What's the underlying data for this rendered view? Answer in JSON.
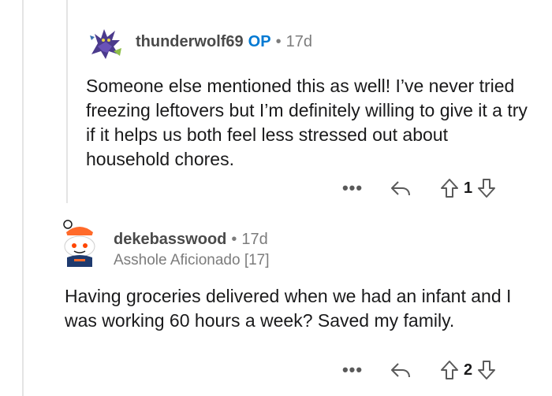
{
  "comments": [
    {
      "username": "thunderwolf69",
      "op_badge": "OP",
      "separator": "•",
      "age": "17d",
      "flair": "",
      "body": "Someone else mentioned this as well! I’ve never tried freezing leftovers but I’m definitely willing to give it a try if it helps us both feel less stressed out about household chores.",
      "score": "1",
      "more_label": "•••",
      "icons": {
        "avatar": "wolf-avatar-icon",
        "reply": "reply-icon",
        "upvote": "upvote-icon",
        "downvote": "downvote-icon"
      }
    },
    {
      "username": "dekebasswood",
      "op_badge": "",
      "separator": "•",
      "age": "17d",
      "flair": "Asshole Aficionado [17]",
      "body": "Having groceries delivered when we had an infant and I was working 60 hours a week? Saved my family.",
      "score": "2",
      "more_label": "•••",
      "icons": {
        "avatar": "snoo-avatar-icon",
        "reply": "reply-icon",
        "upvote": "upvote-icon",
        "downvote": "downvote-icon"
      }
    }
  ],
  "colors": {
    "op": "#0079d3",
    "meta": "#7c7c7c",
    "thread_line": "#e4e4e4",
    "text": "#1a1a1b"
  }
}
